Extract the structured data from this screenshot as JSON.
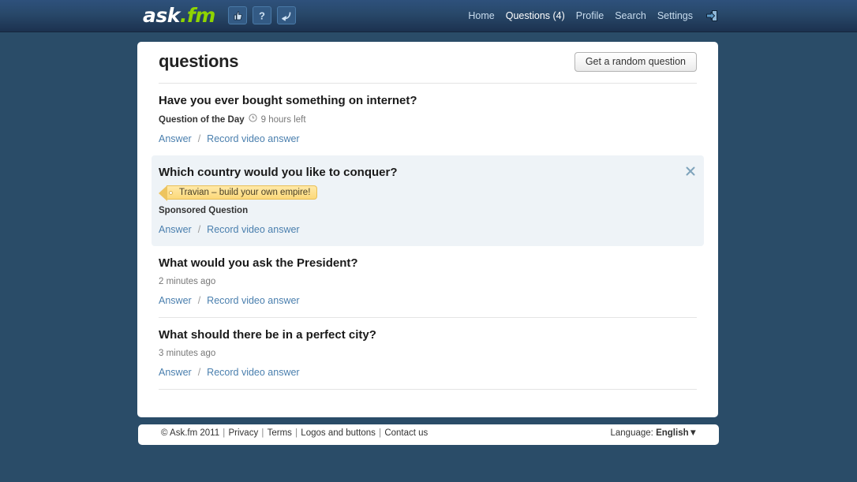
{
  "header": {
    "logo": {
      "part1": "ask",
      "part2": ".fm"
    },
    "icon_buttons": [
      {
        "name": "thumbs-up-icon",
        "title": "Like"
      },
      {
        "name": "question-mark-icon",
        "title": "Help"
      },
      {
        "name": "curved-arrow-icon",
        "title": "Reply"
      }
    ],
    "nav": [
      {
        "label": "Home",
        "active": false
      },
      {
        "label": "Questions (4)",
        "active": true
      },
      {
        "label": "Profile",
        "active": false
      },
      {
        "label": "Search",
        "active": false
      },
      {
        "label": "Settings",
        "active": false
      }
    ],
    "logout_icon": "logout-icon"
  },
  "main": {
    "title": "questions",
    "random_button": "Get a random question",
    "questions": [
      {
        "text": "Have you ever bought something on internet?",
        "meta_label": "Question of the Day",
        "has_clock": true,
        "meta_time": "9 hours left",
        "sponsored": false,
        "tag": null,
        "answer": "Answer",
        "separator": "/",
        "video": "Record video answer"
      },
      {
        "text": "Which country would you like to conquer?",
        "meta_label": "Sponsored Question",
        "has_clock": false,
        "meta_time": "",
        "sponsored": true,
        "tag": "Travian – build your own empire!",
        "answer": "Answer",
        "separator": "/",
        "video": "Record video answer",
        "close": "close-icon"
      },
      {
        "text": "What would you ask the President?",
        "meta_label": "",
        "has_clock": false,
        "meta_time": "2 minutes ago",
        "sponsored": false,
        "tag": null,
        "answer": "Answer",
        "separator": "/",
        "video": "Record video answer"
      },
      {
        "text": "What should there be in a perfect city?",
        "meta_label": "",
        "has_clock": false,
        "meta_time": "3 minutes ago",
        "sponsored": false,
        "tag": null,
        "answer": "Answer",
        "separator": "/",
        "video": "Record video answer"
      }
    ]
  },
  "footer": {
    "copyright": "© Ask.fm 2011",
    "links": [
      "Privacy",
      "Terms",
      "Logos and buttons",
      "Contact us"
    ],
    "language_label": "Language:",
    "language_value": "English",
    "language_caret": "▼"
  }
}
